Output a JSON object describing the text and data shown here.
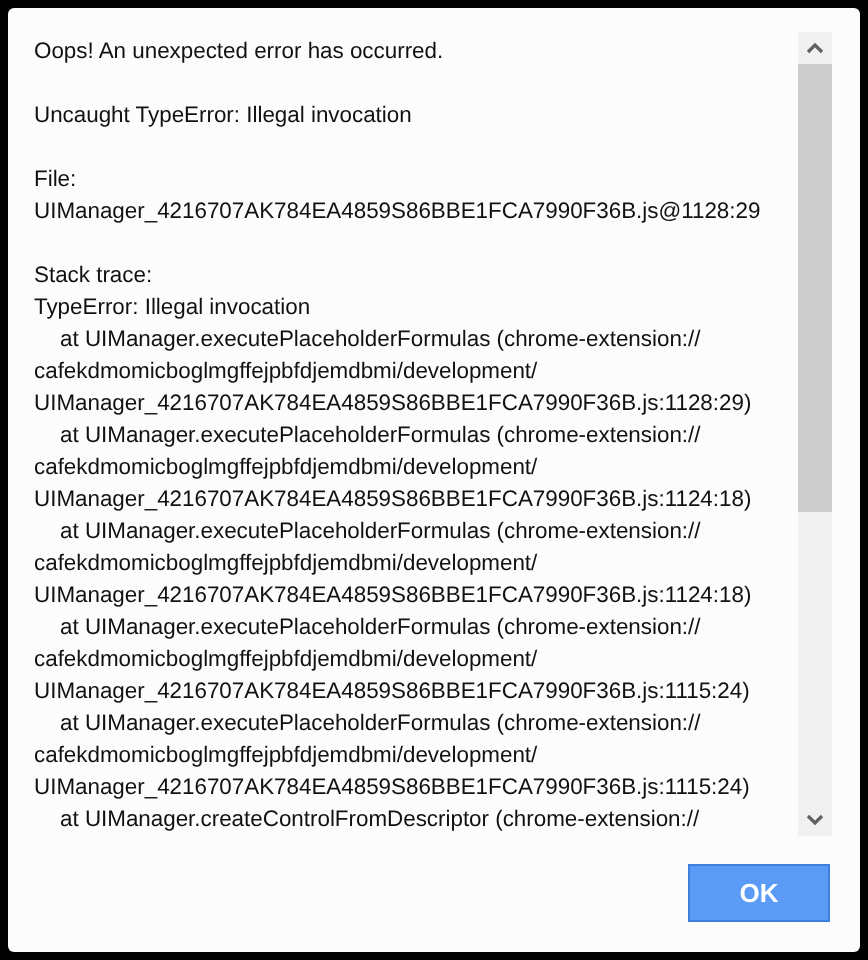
{
  "dialog": {
    "message": "Oops! An unexpected error has occurred.",
    "error": "Uncaught TypeError: Illegal invocation",
    "file": {
      "label": "File:",
      "path": "UIManager_4216707AK784EA4859S86BBE1FCA7990F36B.js@1128:29"
    },
    "stack_trace": {
      "label": "Stack trace:",
      "error": "TypeError: Illegal invocation",
      "frames": [
        {
          "lines": [
            "at UIManager.executePlaceholderFormulas (chrome-extension://",
            "cafekdmomicboglmgffejpbfdjemdbmi/development/",
            "UIManager_4216707AK784EA4859S86BBE1FCA7990F36B.js:1128:29)"
          ]
        },
        {
          "lines": [
            "at UIManager.executePlaceholderFormulas (chrome-extension://",
            "cafekdmomicboglmgffejpbfdjemdbmi/development/",
            "UIManager_4216707AK784EA4859S86BBE1FCA7990F36B.js:1124:18)"
          ]
        },
        {
          "lines": [
            "at UIManager.executePlaceholderFormulas (chrome-extension://",
            "cafekdmomicboglmgffejpbfdjemdbmi/development/",
            "UIManager_4216707AK784EA4859S86BBE1FCA7990F36B.js:1124:18)"
          ]
        },
        {
          "lines": [
            "at UIManager.executePlaceholderFormulas (chrome-extension://",
            "cafekdmomicboglmgffejpbfdjemdbmi/development/",
            "UIManager_4216707AK784EA4859S86BBE1FCA7990F36B.js:1115:24)"
          ]
        },
        {
          "lines": [
            "at UIManager.executePlaceholderFormulas (chrome-extension://",
            "cafekdmomicboglmgffejpbfdjemdbmi/development/",
            "UIManager_4216707AK784EA4859S86BBE1FCA7990F36B.js:1115:24)"
          ]
        },
        {
          "lines": [
            "at UIManager.createControlFromDescriptor (chrome-extension://"
          ]
        }
      ]
    },
    "buttons": [
      "OK"
    ]
  }
}
